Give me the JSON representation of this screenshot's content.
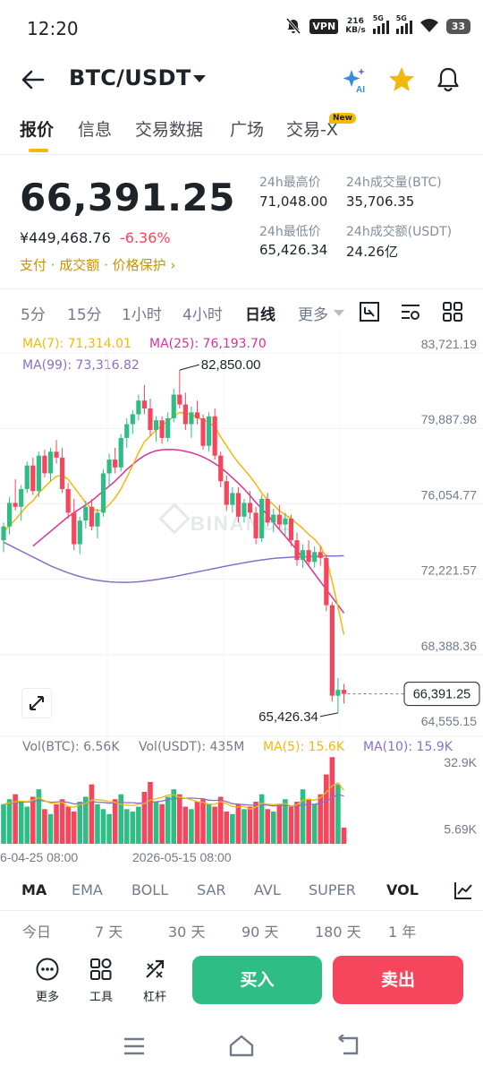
{
  "status_bar": {
    "time": "12:20",
    "vpn": "VPN",
    "net_speed_value": "216",
    "net_speed_unit": "KB/s",
    "sim1": "5G",
    "sim2": "5G",
    "battery": "33",
    "icons": [
      "bell-off-icon",
      "vpn-icon",
      "signal-icon",
      "wifi-icon",
      "battery-icon"
    ]
  },
  "header": {
    "pair": "BTC/USDT",
    "icons": [
      "back-arrow-icon",
      "dropdown-caret-icon",
      "ai-sparkle-icon",
      "star-icon",
      "bell-icon"
    ]
  },
  "tabs": [
    {
      "label": "报价",
      "active": true
    },
    {
      "label": "信息",
      "active": false
    },
    {
      "label": "交易数据",
      "active": false
    },
    {
      "label": "广场",
      "active": false
    },
    {
      "label": "交易-X",
      "active": false
    }
  ],
  "new_badge": "New",
  "price": {
    "last": "66,391.25",
    "cny": "¥449,468.76",
    "change": "-6.36%",
    "links": "支付 · 成交额 · 价格保护 ›"
  },
  "stats": {
    "high_label": "24h最高价",
    "high_value": "71,048.00",
    "vol_btc_label": "24h成交量(BTC)",
    "vol_btc_value": "35,706.35",
    "low_label": "24h最低价",
    "low_value": "65,426.34",
    "vol_usdt_label": "24h成交额(USDT)",
    "vol_usdt_value": "24.26亿"
  },
  "intervals": [
    {
      "label": "5分",
      "active": false
    },
    {
      "label": "15分",
      "active": false
    },
    {
      "label": "1小时",
      "active": false
    },
    {
      "label": "4小时",
      "active": false
    },
    {
      "label": "日线",
      "active": true
    },
    {
      "label": "更多",
      "active": false
    }
  ],
  "interval_icons": [
    "chart-type-icon",
    "chart-settings-icon",
    "grid-layout-icon"
  ],
  "chart_data": {
    "type": "candlestick",
    "watermark": "BINANCE",
    "ma_legend": [
      {
        "label": "MA(7): 71,314.01",
        "color": "#f0b90b"
      },
      {
        "label": "MA(25): 76,193.70",
        "color": "#d9329b"
      },
      {
        "label": "MA(99): 73,316.82",
        "color": "#8a6fc7"
      }
    ],
    "y_ticks": [
      "83,721.19",
      "79,887.98",
      "76,054.77",
      "72,221.57",
      "68,388.36",
      "64,555.15"
    ],
    "ylim": [
      64555.15,
      83721.19
    ],
    "high_marker": "82,850.00",
    "low_marker": "65,426.34",
    "last_price_tag": "66,391.25",
    "up_color": "#2ebd85",
    "down_color": "#f6465d",
    "candles": [
      [
        74200,
        75100,
        73600,
        74900
      ],
      [
        74900,
        76400,
        74500,
        76100
      ],
      [
        76100,
        77300,
        75700,
        75900
      ],
      [
        75900,
        77000,
        75200,
        76800
      ],
      [
        76800,
        78200,
        76600,
        78000
      ],
      [
        78000,
        78400,
        76500,
        76700
      ],
      [
        76700,
        78700,
        76400,
        78500
      ],
      [
        78500,
        78800,
        77400,
        77600
      ],
      [
        77600,
        78900,
        77200,
        78700
      ],
      [
        78700,
        79300,
        78100,
        78400
      ],
      [
        78400,
        78900,
        76600,
        76800
      ],
      [
        76800,
        77100,
        75300,
        75600
      ],
      [
        75600,
        76300,
        73700,
        74000
      ],
      [
        74000,
        75400,
        73500,
        75200
      ],
      [
        75200,
        76200,
        74800,
        75900
      ],
      [
        75900,
        76300,
        74700,
        74900
      ],
      [
        74900,
        75800,
        74300,
        75600
      ],
      [
        75600,
        77800,
        75400,
        77600
      ],
      [
        77600,
        78600,
        77000,
        78300
      ],
      [
        78300,
        78900,
        77600,
        77900
      ],
      [
        77900,
        79600,
        77700,
        79400
      ],
      [
        79400,
        80400,
        78900,
        80100
      ],
      [
        80100,
        80800,
        79600,
        80600
      ],
      [
        80600,
        81600,
        80300,
        81300
      ],
      [
        81300,
        82100,
        80600,
        80900
      ],
      [
        80900,
        81400,
        79500,
        79800
      ],
      [
        79800,
        80500,
        79200,
        80300
      ],
      [
        80300,
        80500,
        79100,
        79400
      ],
      [
        79400,
        80700,
        79200,
        80400
      ],
      [
        80400,
        81900,
        80200,
        81600
      ],
      [
        81600,
        82850,
        80900,
        81100
      ],
      [
        81100,
        81700,
        79800,
        80100
      ],
      [
        80100,
        81000,
        79400,
        80700
      ],
      [
        80700,
        81300,
        80100,
        80400
      ],
      [
        80400,
        80600,
        78800,
        79000
      ],
      [
        79000,
        80700,
        78700,
        80500
      ],
      [
        80500,
        80900,
        78300,
        78500
      ],
      [
        78500,
        78700,
        76900,
        77200
      ],
      [
        77200,
        77500,
        75700,
        76000
      ],
      [
        76000,
        76900,
        75600,
        76600
      ],
      [
        76600,
        76900,
        75100,
        75400
      ],
      [
        75400,
        76300,
        75100,
        76100
      ],
      [
        76100,
        76700,
        75300,
        75600
      ],
      [
        75600,
        75900,
        74000,
        74300
      ],
      [
        74300,
        76500,
        74100,
        76300
      ],
      [
        76300,
        76600,
        74900,
        75100
      ],
      [
        75100,
        75800,
        74600,
        75500
      ],
      [
        75500,
        76000,
        74700,
        75000
      ],
      [
        75000,
        75600,
        74400,
        75300
      ],
      [
        75300,
        75500,
        73900,
        74200
      ],
      [
        74200,
        74600,
        72900,
        73200
      ],
      [
        73200,
        74000,
        72800,
        73700
      ],
      [
        73700,
        74200,
        72900,
        73100
      ],
      [
        73100,
        73900,
        72800,
        73600
      ],
      [
        73600,
        73900,
        72900,
        73300
      ],
      [
        73300,
        73500,
        70600,
        70900
      ],
      [
        70900,
        71050,
        66000,
        66300
      ],
      [
        66300,
        67200,
        65426,
        66600
      ],
      [
        66600,
        66900,
        65900,
        66391
      ]
    ],
    "ma7": [
      74600,
      74950,
      75250,
      75600,
      75950,
      76200,
      76600,
      76900,
      77200,
      77450,
      77500,
      77300,
      76900,
      76500,
      76100,
      75800,
      75700,
      75750,
      76000,
      76350,
      76800,
      77400,
      78000,
      78650,
      79200,
      79500,
      79800,
      80050,
      80250,
      80500,
      80700,
      80650,
      80600,
      80450,
      80300,
      80200,
      79950,
      79450,
      79000,
      78550,
      78150,
      77800,
      77450,
      77050,
      76600,
      76250,
      76000,
      75700,
      75500,
      75300,
      75050,
      74800,
      74500,
      74250,
      73900,
      73300,
      72100,
      70800,
      69400
    ],
    "ma25_start": 5,
    "ma25": [
      73900,
      74150,
      74400,
      74650,
      74900,
      75150,
      75400,
      75600,
      75800,
      76000,
      76200,
      76450,
      76700,
      76950,
      77200,
      77500,
      77800,
      78050,
      78300,
      78500,
      78650,
      78750,
      78800,
      78820,
      78810,
      78780,
      78720,
      78650,
      78550,
      78430,
      78280,
      78100,
      77900,
      77650,
      77380,
      77100,
      76800,
      76470,
      76120,
      75800,
      75480,
      75100,
      74750,
      74400,
      74050,
      73700,
      73300,
      72900,
      72500,
      72100,
      71700,
      71300,
      70900,
      70500
    ],
    "ma99": [
      74100,
      73950,
      73800,
      73650,
      73500,
      73350,
      73200,
      73050,
      72900,
      72780,
      72660,
      72550,
      72450,
      72360,
      72280,
      72210,
      72160,
      72120,
      72090,
      72070,
      72060,
      72060,
      72070,
      72090,
      72120,
      72160,
      72200,
      72250,
      72300,
      72350,
      72410,
      72470,
      72530,
      72590,
      72650,
      72710,
      72770,
      72830,
      72890,
      72950,
      73000,
      73060,
      73110,
      73160,
      73200,
      73240,
      73280,
      73300,
      73320,
      73340,
      73350,
      73360,
      73370,
      73380,
      73390,
      73395,
      73400,
      73405,
      73410
    ],
    "volume": {
      "legend": [
        {
          "label": "Vol(BTC): 6.56K",
          "color": "#707a8a"
        },
        {
          "label": "Vol(USDT): 435M",
          "color": "#707a8a"
        },
        {
          "label": "MA(5): 15.6K",
          "color": "#f0b90b"
        },
        {
          "label": "MA(10): 15.9K",
          "color": "#8a6fc7"
        }
      ],
      "y_ticks": [
        "32.9K",
        "5.69K"
      ],
      "ylim": [
        0,
        34
      ],
      "values": [
        16,
        18,
        20,
        17,
        15,
        19,
        22,
        14,
        12,
        16,
        18,
        15,
        13,
        17,
        19,
        24,
        16,
        14,
        12,
        18,
        20,
        14,
        13,
        15,
        21,
        25,
        17,
        16,
        19,
        22,
        20,
        15,
        14,
        17,
        18,
        16,
        15,
        19,
        13,
        12,
        16,
        14,
        15,
        17,
        20,
        14,
        13,
        16,
        18,
        15,
        17,
        22,
        18,
        16,
        20,
        28,
        35,
        24,
        6.56
      ],
      "ma5": [
        16,
        16.5,
        17,
        17.2,
        17,
        17.6,
        18.6,
        17.4,
        16.4,
        16.6,
        16.8,
        15,
        14.8,
        15.8,
        16.4,
        17.6,
        17.8,
        17.6,
        17,
        16.8,
        16,
        15.6,
        15.4,
        16,
        16.2,
        17.6,
        18.2,
        18.8,
        19.6,
        19.8,
        18.8,
        18.4,
        17.8,
        17,
        16.8,
        16,
        16,
        17,
        16.2,
        15,
        14.8,
        15.2,
        14,
        14.8,
        16.4,
        16,
        15.8,
        16,
        16.2,
        15.2,
        15.8,
        17.6,
        18,
        17.6,
        18.6,
        20.8,
        23.4,
        24.6,
        21.6
      ],
      "ma10": [
        16,
        16.3,
        16.6,
        16.8,
        16.9,
        17.1,
        17.6,
        17.2,
        16.8,
        16.9,
        17,
        16.7,
        16.1,
        16.2,
        16.5,
        17,
        16.8,
        16.7,
        16.4,
        16.6,
        16.8,
        16.6,
        16.6,
        16.4,
        16.6,
        16.8,
        17,
        17.2,
        17.9,
        18.3,
        18.3,
        18.4,
        18.5,
        18.3,
        18.2,
        17.6,
        17.5,
        17.8,
        17,
        16.2,
        16,
        15.8,
        15.6,
        15.6,
        15.8,
        15.6,
        15.3,
        15.4,
        15.5,
        15.3,
        15.3,
        15.7,
        15.9,
        16,
        16.4,
        17.2,
        18.6,
        19.9,
        19.3
      ],
      "last_close_up": false
    },
    "x_ticks": [
      "6-04-25 08:00",
      "2026-05-15 08:00"
    ]
  },
  "indicator_tabs": [
    {
      "label": "MA",
      "active": true
    },
    {
      "label": "EMA",
      "active": false
    },
    {
      "label": "BOLL",
      "active": false
    },
    {
      "label": "SAR",
      "active": false
    },
    {
      "label": "AVL",
      "active": false
    },
    {
      "label": "SUPER",
      "active": false
    },
    {
      "label": "VOL",
      "active": true
    }
  ],
  "indicator_settings_icon": "indicator-settings-icon",
  "performance_periods": [
    "今日",
    "7 天",
    "30 天",
    "90 天",
    "180 天",
    "1 年"
  ],
  "bottom_bar": {
    "more": "更多",
    "tools": "工具",
    "leverage": "杠杆",
    "buy": "买入",
    "sell": "卖出",
    "icons": [
      "more-dots-icon",
      "tools-grid-icon",
      "leverage-icon"
    ]
  },
  "nav_bar": {
    "icons": [
      "menu-lines-icon",
      "home-icon",
      "back-nav-icon"
    ]
  }
}
